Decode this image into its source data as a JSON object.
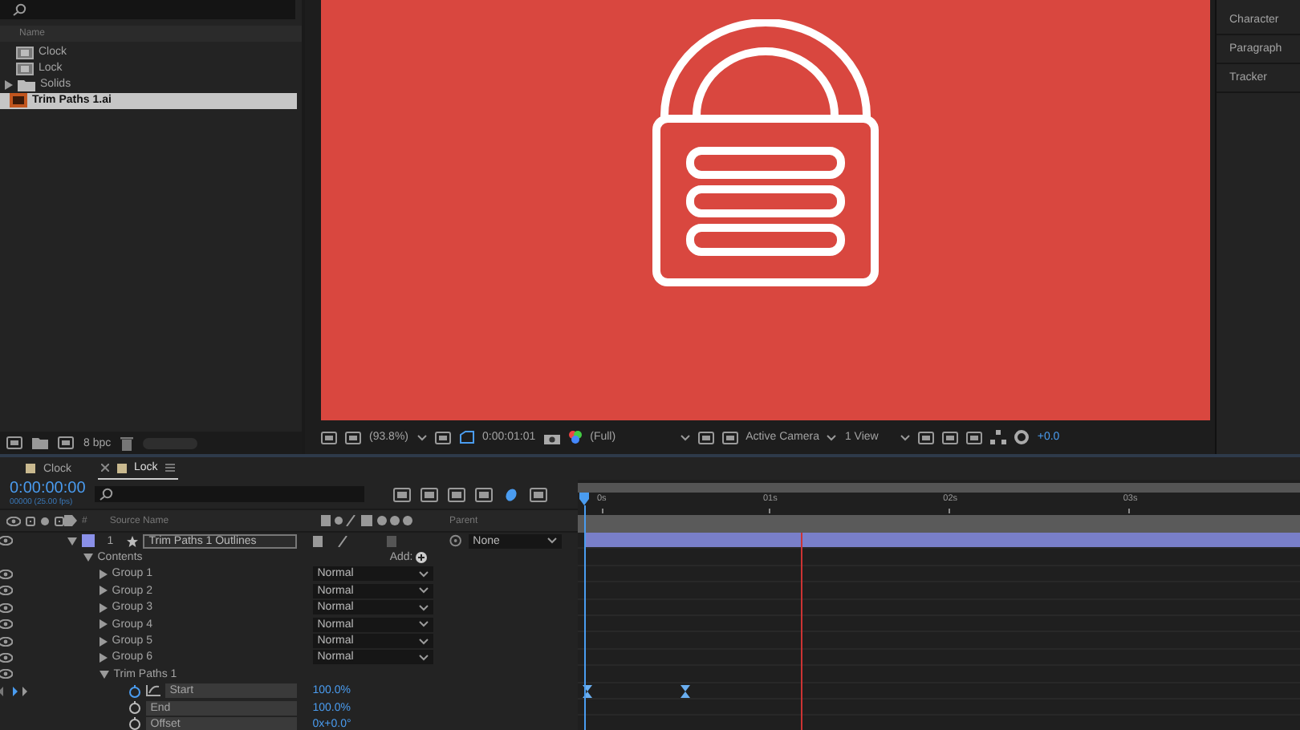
{
  "project": {
    "column": "Name",
    "items": [
      {
        "name": "Clock",
        "kind": "comp",
        "selected": false
      },
      {
        "name": "Lock",
        "kind": "comp",
        "selected": false
      },
      {
        "name": "Solids",
        "kind": "folder",
        "selected": false
      },
      {
        "name": "Trim Paths 1.ai",
        "kind": "ai",
        "selected": true
      }
    ],
    "bit_depth": "8 bpc"
  },
  "viewer": {
    "zoom": "(93.8%)",
    "time": "0:00:01:01",
    "resolution": "(Full)",
    "camera": "Active Camera",
    "views": "1 View",
    "exposure": "+0.0"
  },
  "side_panel": {
    "items": [
      "Character",
      "Paragraph",
      "Tracker"
    ]
  },
  "timeline": {
    "tabs": [
      {
        "label": "Clock",
        "selected": false
      },
      {
        "label": "Lock",
        "selected": true
      }
    ],
    "timecode": "0:00:00:00",
    "fps": "00000 (25.00 fps)",
    "columns": {
      "number": "#",
      "source": "Source Name",
      "parent": "Parent"
    },
    "ruler": [
      "0s",
      "01s",
      "02s",
      "03s"
    ],
    "layers": [
      {
        "kind": "layer",
        "number": "1",
        "name": "Trim Paths 1 Outlines",
        "color": "#8a90e8",
        "parent": "None",
        "expanded": true,
        "eye": true,
        "children": [
          {
            "kind": "group",
            "name": "Contents",
            "add_label": "Add:",
            "expanded": true,
            "eye": false,
            "children": [
              {
                "kind": "group",
                "name": "Group 1",
                "mode": "Normal",
                "expanded": false,
                "eye": true
              },
              {
                "kind": "group",
                "name": "Group 2",
                "mode": "Normal",
                "expanded": false,
                "eye": true
              },
              {
                "kind": "group",
                "name": "Group 3",
                "mode": "Normal",
                "expanded": false,
                "eye": true
              },
              {
                "kind": "group",
                "name": "Group 4",
                "mode": "Normal",
                "expanded": false,
                "eye": true
              },
              {
                "kind": "group",
                "name": "Group 5",
                "mode": "Normal",
                "expanded": false,
                "eye": true
              },
              {
                "kind": "group",
                "name": "Group 6",
                "mode": "Normal",
                "expanded": false,
                "eye": true
              },
              {
                "kind": "group",
                "name": "Trim Paths 1",
                "expanded": true,
                "eye": true,
                "children": [
                  {
                    "kind": "property",
                    "name": "Start",
                    "value": "100.0%",
                    "stopwatch": true
                  },
                  {
                    "kind": "property",
                    "name": "End",
                    "value": "100.0%",
                    "stopwatch": false
                  },
                  {
                    "kind": "property",
                    "name": "Offset",
                    "value": "0x+0.0°",
                    "stopwatch": false
                  }
                ]
              }
            ]
          }
        ]
      }
    ]
  }
}
